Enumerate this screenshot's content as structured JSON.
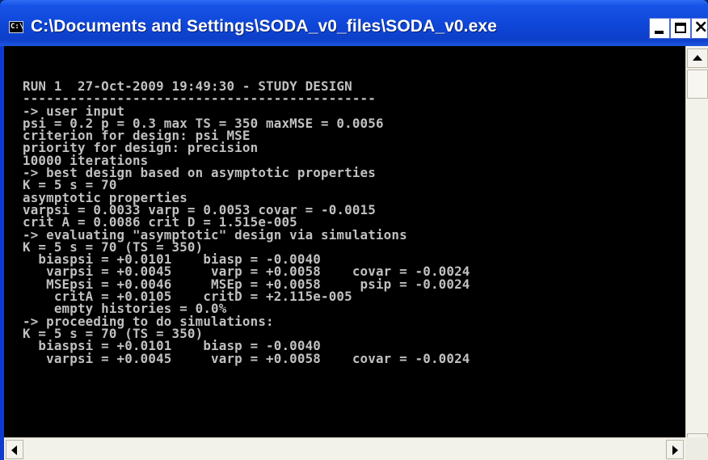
{
  "window": {
    "title": "C:\\Documents and Settings\\SODA_v0_files\\SODA_v0.exe",
    "icon": "cmd-icon",
    "icon_text": "C:\\"
  },
  "controls": {
    "minimize": "minimize-icon",
    "maximize": "maximize-icon",
    "close": "close-icon",
    "close_glyph": "×"
  },
  "console": {
    "background": "#000000",
    "foreground": "#c0c0c0",
    "lines": [
      "RUN 1  27-Oct-2009 19:49:30 - STUDY DESIGN",
      "---------------------------------------------",
      "-> user input",
      "psi = 0.2 p = 0.3 max TS = 350 maxMSE = 0.0056",
      "criterion for design: psi MSE",
      "priority for design: precision",
      "10000 iterations",
      "-> best design based on asymptotic properties",
      "K = 5 s = 70",
      "asymptotic properties",
      "varpsi = 0.0033 varp = 0.0053 covar = -0.0015",
      "crit A = 0.0086 crit D = 1.515e-005",
      "-> evaluating \"asymptotic\" design via simulations",
      "K = 5 s = 70 (TS = 350)",
      "  biaspsi = +0.0101    biasp = -0.0040",
      "   varpsi = +0.0045     varp = +0.0058    covar = -0.0024",
      "   MSEpsi = +0.0046     MSEp = +0.0058     psip = -0.0024",
      "    critA = +0.0105    critD = +2.115e-005",
      "    empty histories = 0.0%",
      "-> proceeding to do simulations:",
      "K = 5 s = 70 (TS = 350)",
      "  biaspsi = +0.0101    biasp = -0.0040",
      "   varpsi = +0.0045     varp = +0.0058    covar = -0.0024"
    ]
  },
  "scrollbars": {
    "up": "arrow-up-icon",
    "down": "arrow-down-icon",
    "left": "arrow-left-icon",
    "right": "arrow-right-icon"
  }
}
